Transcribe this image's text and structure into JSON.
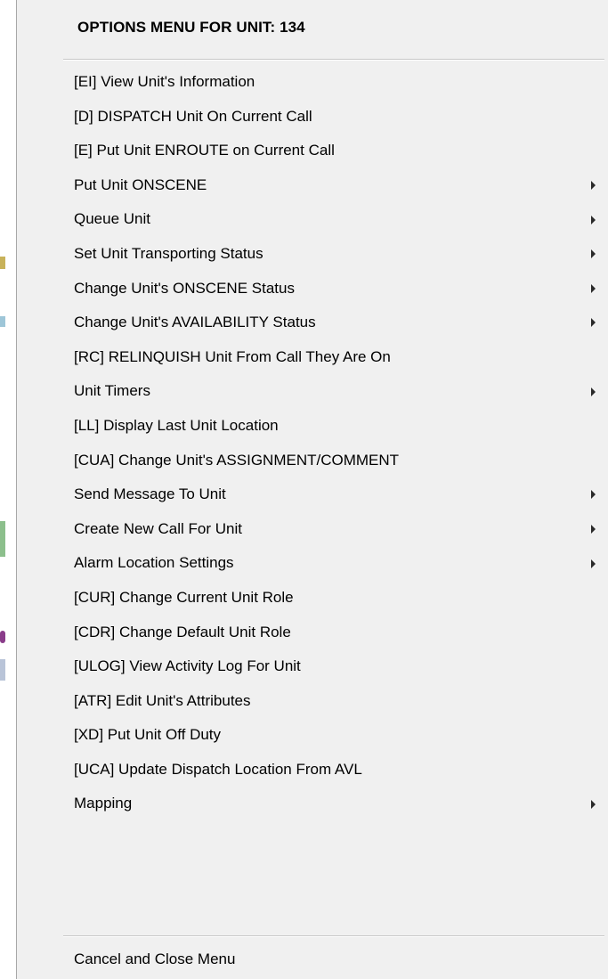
{
  "menu": {
    "title": "OPTIONS MENU FOR UNIT:  134",
    "items": [
      {
        "label": "[EI] View Unit's Information",
        "submenu": false
      },
      {
        "label": "[D] DISPATCH Unit On Current Call",
        "submenu": false
      },
      {
        "label": "[E] Put Unit ENROUTE on Current Call",
        "submenu": false
      },
      {
        "label": "Put Unit ONSCENE",
        "submenu": true
      },
      {
        "label": "Queue Unit",
        "submenu": true
      },
      {
        "label": "Set Unit Transporting Status",
        "submenu": true
      },
      {
        "label": "Change Unit's ONSCENE Status",
        "submenu": true
      },
      {
        "label": "Change Unit's AVAILABILITY Status",
        "submenu": true
      },
      {
        "label": "[RC] RELINQUISH Unit From Call They Are On",
        "submenu": false
      },
      {
        "label": "Unit Timers",
        "submenu": true
      },
      {
        "label": "[LL] Display Last Unit Location",
        "submenu": false
      },
      {
        "label": "[CUA] Change Unit's ASSIGNMENT/COMMENT",
        "submenu": false
      },
      {
        "label": "Send Message To Unit",
        "submenu": true
      },
      {
        "label": "Create New Call For Unit",
        "submenu": true
      },
      {
        "label": "Alarm Location Settings",
        "submenu": true
      },
      {
        "label": "[CUR] Change Current Unit Role",
        "submenu": false
      },
      {
        "label": "[CDR] Change Default Unit Role",
        "submenu": false
      },
      {
        "label": "[ULOG] View Activity Log For Unit",
        "submenu": false
      },
      {
        "label": "[ATR] Edit Unit's Attributes",
        "submenu": false
      },
      {
        "label": "[XD] Put Unit Off Duty",
        "submenu": false
      },
      {
        "label": "[UCA] Update Dispatch Location From AVL",
        "submenu": false
      },
      {
        "label": "Mapping",
        "submenu": true
      }
    ],
    "cancel_label": "Cancel and Close Menu"
  },
  "colors": {
    "menu_background": "#f0f0f0",
    "separator": "#c8c8c8",
    "background_highlight": "#ffff00"
  },
  "icons": {
    "submenu_arrow": "submenu-arrow-icon"
  }
}
